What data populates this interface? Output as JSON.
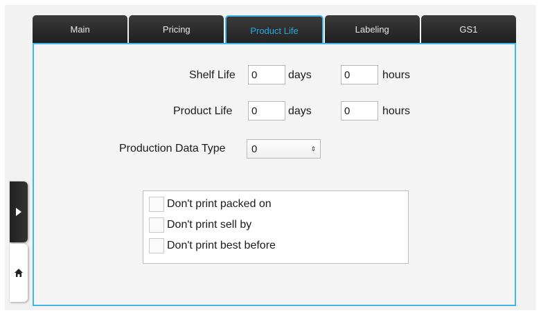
{
  "tabs": [
    {
      "label": "Main",
      "active": false
    },
    {
      "label": "Pricing",
      "active": false
    },
    {
      "label": "Product Life",
      "active": true
    },
    {
      "label": "Labeling",
      "active": false
    },
    {
      "label": "GS1",
      "active": false
    }
  ],
  "shelf_life": {
    "label": "Shelf Life",
    "days_value": "0",
    "days_unit": "days",
    "hours_value": "0",
    "hours_unit": "hours"
  },
  "product_life": {
    "label": "Product Life",
    "days_value": "0",
    "days_unit": "days",
    "hours_value": "0",
    "hours_unit": "hours"
  },
  "production_data_type": {
    "label": "Production Data Type",
    "selected": "0"
  },
  "options": [
    {
      "label": "Don't print packed on",
      "checked": false
    },
    {
      "label": "Don't print sell by",
      "checked": false
    },
    {
      "label": "Don't print best before",
      "checked": false
    }
  ],
  "side_controls": {
    "expand_icon": "play-triangle-icon",
    "home_icon": "home-icon"
  },
  "colors": {
    "accent": "#3db6ec",
    "active_tab_text": "#29a8e0",
    "tab_bg": "#2a2a2a"
  }
}
